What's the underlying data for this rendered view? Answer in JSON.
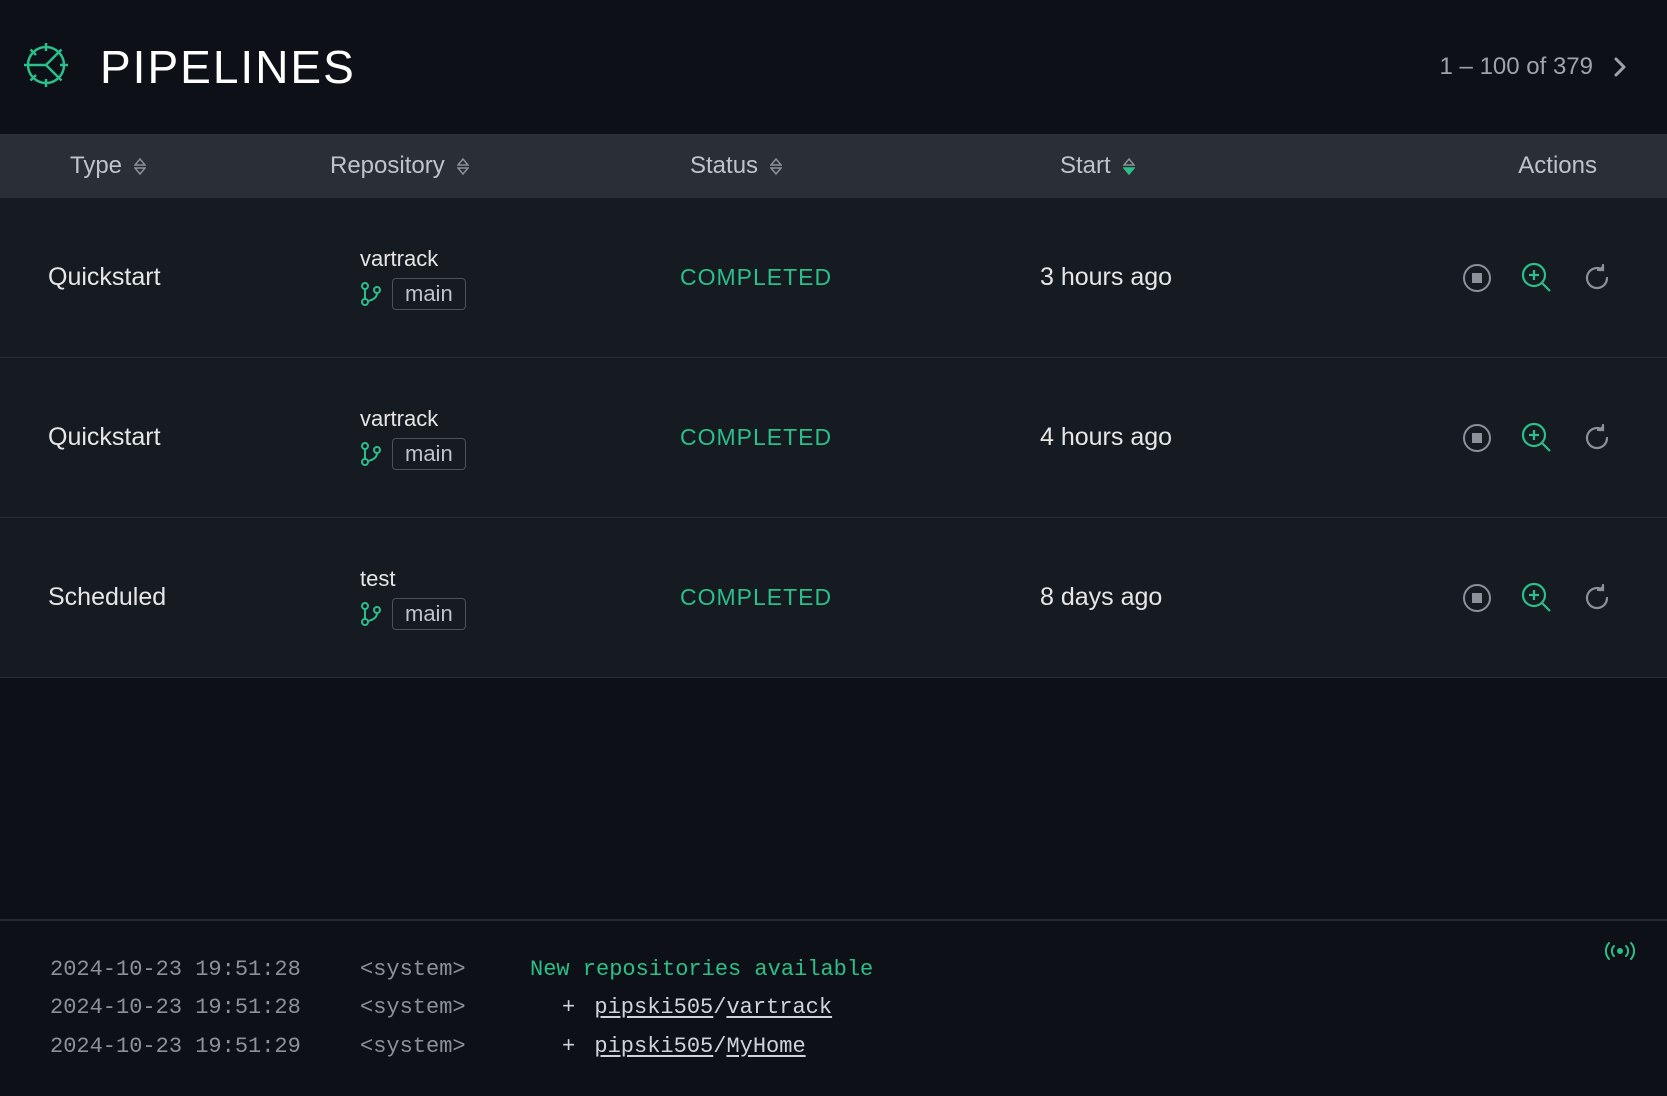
{
  "header": {
    "title": "PIPELINES"
  },
  "pagination": {
    "range_start": 1,
    "range_end": 100,
    "total": 379,
    "text": "1 – 100 of 379"
  },
  "columns": {
    "type": "Type",
    "repository": "Repository",
    "status": "Status",
    "start": "Start",
    "actions": "Actions"
  },
  "rows": [
    {
      "type": "Quickstart",
      "repo": "vartrack",
      "branch": "main",
      "status": "COMPLETED",
      "start": "3 hours ago"
    },
    {
      "type": "Quickstart",
      "repo": "vartrack",
      "branch": "main",
      "status": "COMPLETED",
      "start": "4 hours ago"
    },
    {
      "type": "Scheduled",
      "repo": "test",
      "branch": "main",
      "status": "COMPLETED",
      "start": "8 days ago"
    }
  ],
  "console": {
    "lines": [
      {
        "ts": "2024-10-23 19:51:28",
        "src": "<system>",
        "msg": "New repositories available",
        "kind": "header"
      },
      {
        "ts": "2024-10-23 19:51:28",
        "src": "<system>",
        "owner": "pipski505",
        "repo": "vartrack",
        "kind": "repo"
      },
      {
        "ts": "2024-10-23 19:51:29",
        "src": "<system>",
        "owner": "pipski505",
        "repo": "MyHome",
        "kind": "repo"
      }
    ]
  }
}
